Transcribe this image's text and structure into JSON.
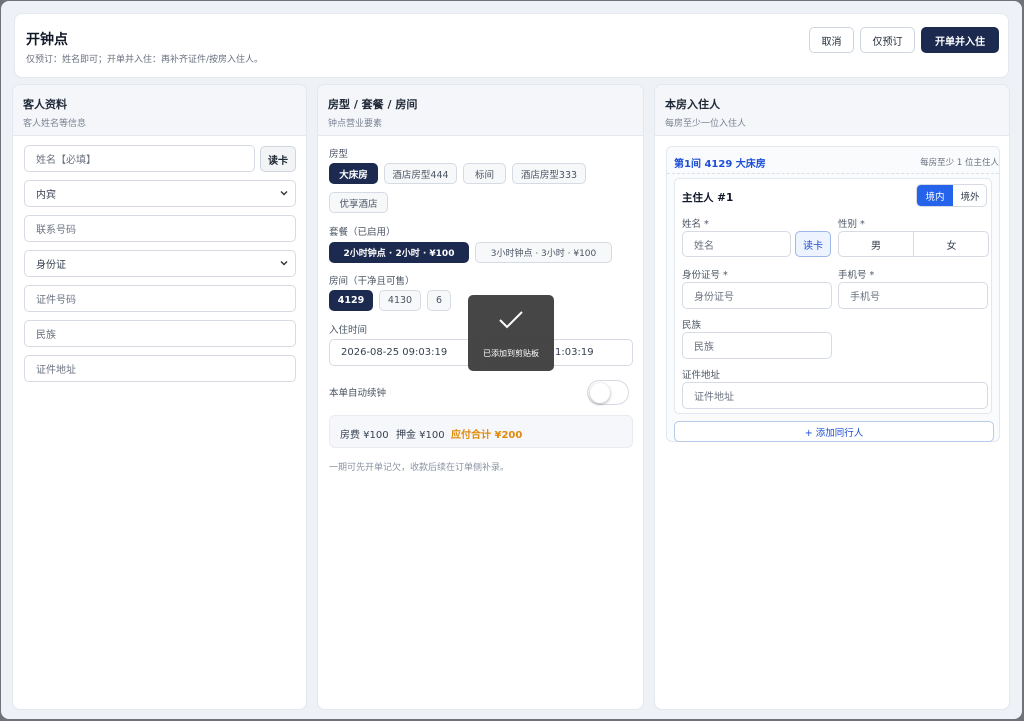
{
  "header": {
    "title": "开钟点",
    "subtitle": "仅预订：姓名即可；开单并入住：再补齐证件/按房入住人。",
    "cancel_label": "取消",
    "reserve_label": "仅预订",
    "checkin_label": "开单并入住"
  },
  "guest": {
    "title": "客人资料",
    "subtitle": "客人姓名等信息",
    "name_placeholder": "姓名【必填】",
    "read_card_label": "读卡",
    "guest_type_value": "内宾",
    "phone_placeholder": "联系号码",
    "id_type_value": "身份证",
    "id_no_placeholder": "证件号码",
    "ethnicity_placeholder": "民族",
    "address_placeholder": "证件地址"
  },
  "room": {
    "title": "房型 / 套餐 / 房间",
    "subtitle": "钟点营业要素",
    "room_type_label": "房型",
    "room_types": [
      "大床房",
      "酒店房型444",
      "标间",
      "酒店房型333",
      "优享酒店"
    ],
    "package_label": "套餐（已启用）",
    "packages": [
      "2小时钟点 · 2小时 · ¥100",
      "3小时钟点 · 3小时 · ¥100"
    ],
    "rooms_label": "房间（干净且可售）",
    "rooms": [
      "4129",
      "4130",
      "6"
    ],
    "checkin_time_label": "入住时间",
    "checkin_time_value": "2026-08-25 09:03:19",
    "checkout_time_value_partial": "1:03:19",
    "auto_renew_label": "本单自动续钟",
    "auto_renew_on": false,
    "fee_room": "房费 ¥100",
    "fee_deposit": "押金 ¥100",
    "fee_total": "应付合计 ¥200",
    "note": "一期可先开单记欠，收款后续在订单侧补录。"
  },
  "occupants": {
    "title": "本房入住人",
    "subtitle": "每房至少一位入住人",
    "room_title": "第1间 4129 大床房",
    "room_hint": "每房至少 1 位主住人",
    "primary_title": "主住人 #1",
    "domestic_label": "境内",
    "foreign_label": "境外",
    "name_label": "姓名 *",
    "name_placeholder": "姓名",
    "read_card_label": "读卡",
    "gender_label": "性别 *",
    "male_label": "男",
    "female_label": "女",
    "id_label": "身份证号 *",
    "id_placeholder": "身份证号",
    "phone_label": "手机号 *",
    "phone_placeholder": "手机号",
    "ethnicity_label": "民族",
    "ethnicity_placeholder": "民族",
    "address_label": "证件地址",
    "address_placeholder": "证件地址",
    "add_companion_label": "+ 添加同行人"
  },
  "toast": {
    "message": "已添加到剪贴板",
    "icon": "checkmark-icon"
  },
  "colors": {
    "primary": "#1b2a4e",
    "accent_blue": "#2563eb",
    "total_orange": "#e08a0b"
  }
}
